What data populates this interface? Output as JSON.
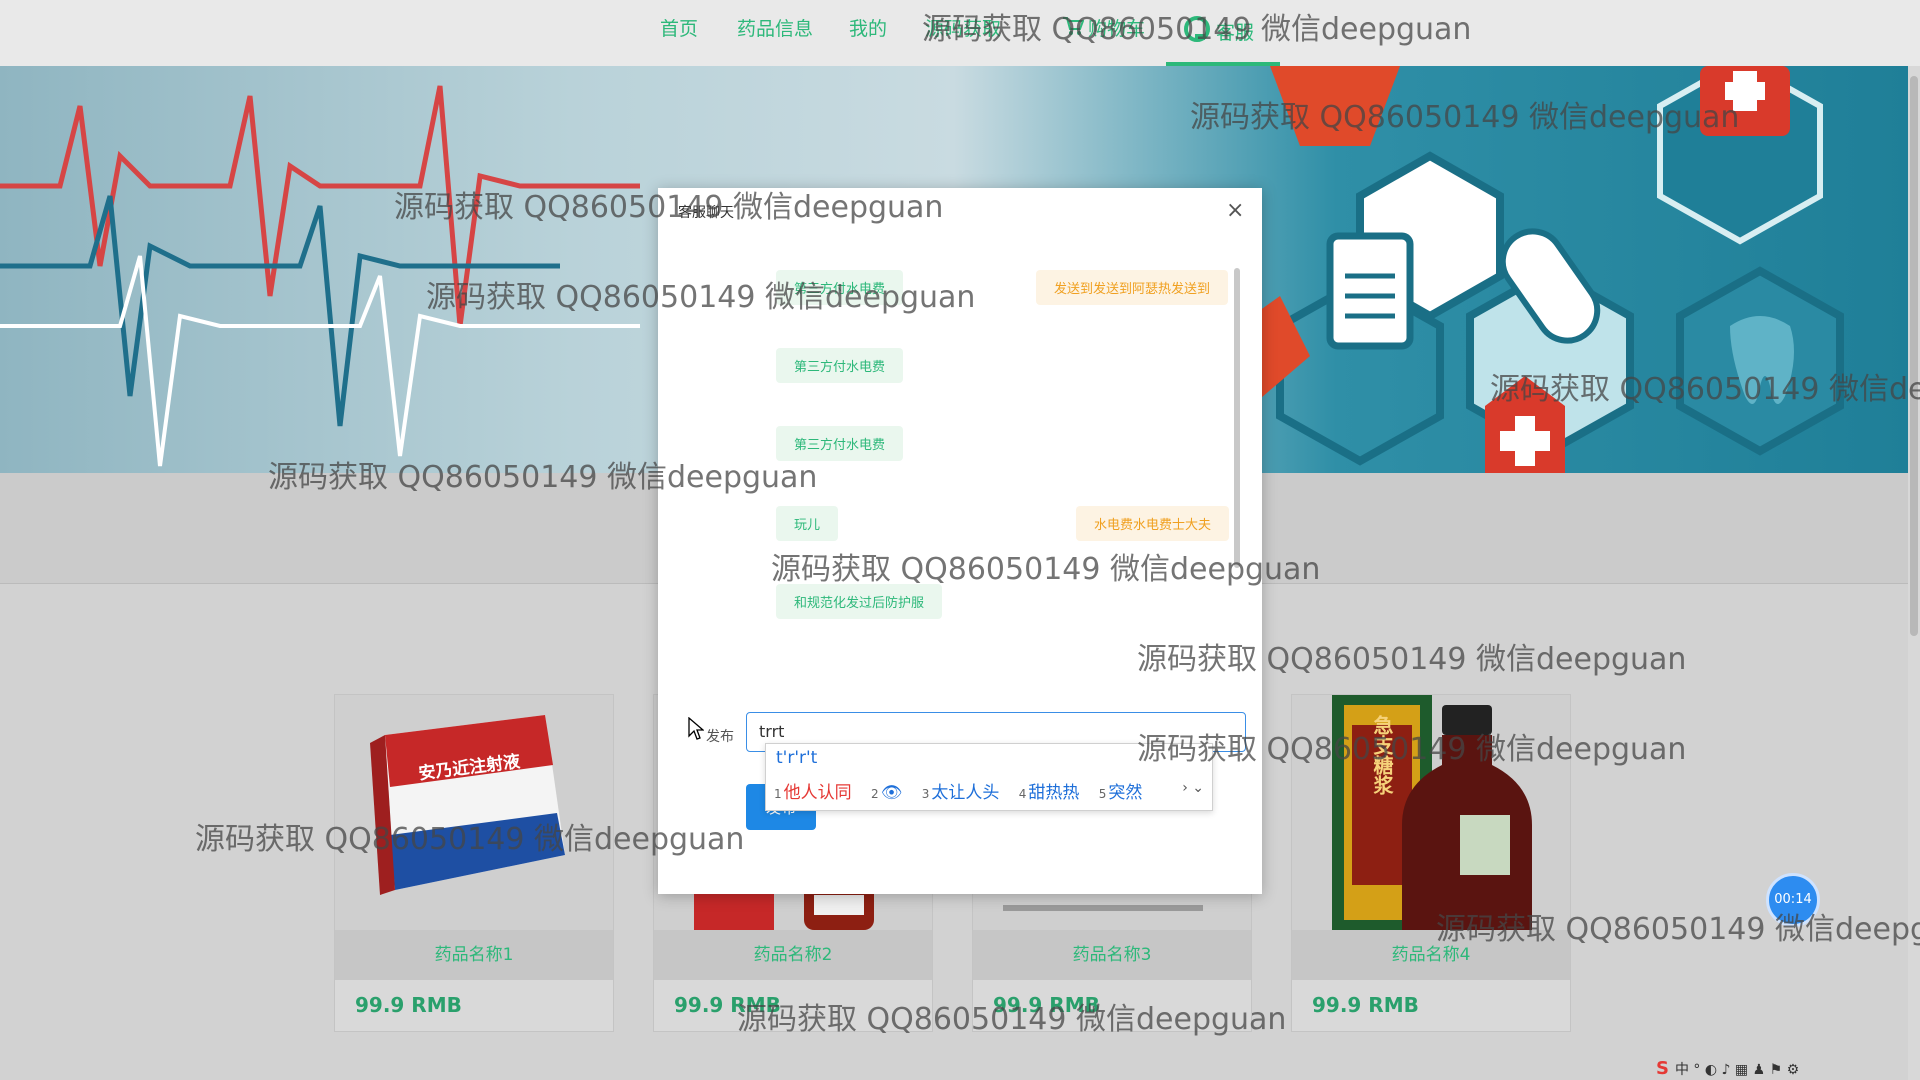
{
  "nav": {
    "items": [
      {
        "label": "首页"
      },
      {
        "label": "药品信息"
      },
      {
        "label": "我的"
      },
      {
        "label": "源码获取"
      },
      {
        "label": "购物车"
      },
      {
        "label": "客服"
      }
    ],
    "active": "客服"
  },
  "modal": {
    "title": "客服聊天",
    "close_glyph": "×",
    "messages": [
      {
        "side": "left",
        "text": "第三方付水电费"
      },
      {
        "side": "right",
        "text": "发送到发送到阿瑟热发送到"
      },
      {
        "side": "left",
        "text": "第三方付水电费"
      },
      {
        "side": "left",
        "text": "第三方付水电费"
      },
      {
        "side": "left",
        "text": "玩儿"
      },
      {
        "side": "right",
        "text": "水电费水电费士大夫"
      },
      {
        "side": "left",
        "text": "和规范化发过后防护服"
      }
    ],
    "publish_label": "发布",
    "input_value": "trrt",
    "publish_button": "发布"
  },
  "ime": {
    "composition": "t'r'r't",
    "candidates": [
      {
        "n": "1",
        "text": "他人认同"
      },
      {
        "n": "2",
        "text": "👁"
      },
      {
        "n": "3",
        "text": "太让人头"
      },
      {
        "n": "4",
        "text": "甜热热"
      },
      {
        "n": "5",
        "text": "突然"
      }
    ],
    "nav_glyphs": "› ⌄"
  },
  "products": [
    {
      "name": "药品名称1",
      "price": "99.9 RMB",
      "box_text": "安乃近注射液"
    },
    {
      "name": "药品名称2",
      "price": "99.9 RMB"
    },
    {
      "name": "药品名称3",
      "price": "99.9 RMB"
    },
    {
      "name": "药品名称4",
      "price": "99.9 RMB",
      "box_text": "急支糖浆"
    }
  ],
  "timer": "00:14",
  "tray": {
    "logo": "S",
    "text": "中 ° ◐ ♪ ▦ ♟ ⚑ ⚙"
  },
  "watermark": "源码获取 QQ86050149 微信deepguan",
  "watermark_cut": "源码获取 QQ86050149 微信de",
  "watermark_cut2": "源码获取 QQ86050149 微信deepg"
}
